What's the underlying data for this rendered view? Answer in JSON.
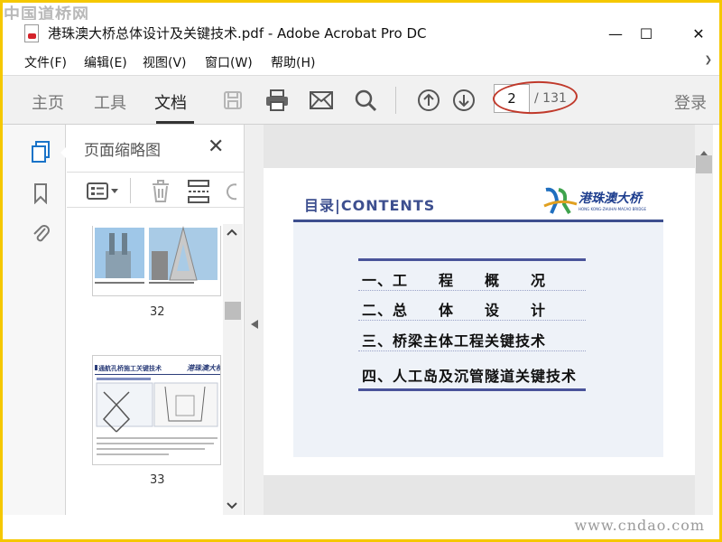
{
  "watermark": {
    "top": "中国道桥网",
    "bottom": "www.cndao.com"
  },
  "window": {
    "title": "港珠澳大桥总体设计及关键技术.pdf - Adobe Acrobat Pro DC",
    "minimize": "—",
    "maximize": "☐",
    "close": "✕"
  },
  "menu": {
    "items": [
      {
        "label": "文件(F)"
      },
      {
        "label": "编辑(E)"
      },
      {
        "label": "视图(V)"
      },
      {
        "label": "窗口(W)"
      },
      {
        "label": "帮助(H)"
      }
    ],
    "overflow": "❯"
  },
  "toolbar": {
    "tabs": [
      {
        "label": "主页"
      },
      {
        "label": "工具"
      },
      {
        "label": "文档"
      }
    ],
    "active_tab": "文档",
    "current_page": "2",
    "total_pages": "/ 131",
    "login_label": "登录"
  },
  "panel": {
    "title": "页面缩略图",
    "close": "✕",
    "thumbnails": [
      {
        "number": "32"
      },
      {
        "number": "33",
        "heading": "通航孔桥施工关键技术"
      }
    ]
  },
  "document": {
    "slide_title": "目录|CONTENTS",
    "logo_text": "港珠澳大桥",
    "logo_subtext": "HONG KONG-ZHUHAI-MACAO BRIDGE",
    "toc": [
      {
        "label": "一、工　　程　　概　　况"
      },
      {
        "label": "二、总　　体　　设　　计"
      },
      {
        "label": "三、桥梁主体工程关键技术"
      },
      {
        "label": "四、人工岛及沉管隧道关键技术"
      }
    ]
  },
  "colors": {
    "accent": "#3d4f8f",
    "frame": "#f5c800",
    "annotation": "#c0392b"
  }
}
